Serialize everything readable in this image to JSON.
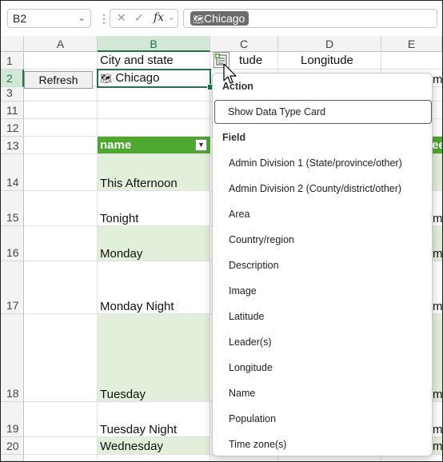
{
  "formula_bar": {
    "name_box": "B2",
    "cancel_glyph": "✕",
    "enter_glyph": "✓",
    "fx_label": "fx",
    "chip_icon": "🗺",
    "chip_text": "Chicago"
  },
  "columns": [
    "A",
    "B",
    "C",
    "D",
    "E"
  ],
  "rows": [
    "1",
    "2",
    "3",
    "11",
    "12",
    "13",
    "14",
    "15",
    "16",
    "17",
    "18",
    "19",
    "20"
  ],
  "cells": {
    "b1": "City and state",
    "c1_partial": "tude",
    "d1": "Longitude",
    "a2_button": "Refresh",
    "b2_icon": "🗺",
    "b2": "Chicago",
    "e2_partial": "mp",
    "b13_header": "name",
    "e13_partial": "ee",
    "b14": "This Afternoon",
    "b15": "Tonight",
    "e15_partial": "mp",
    "b16": "Monday",
    "e16_partial": "mp",
    "b17": "Monday Night",
    "e17_partial": "mp",
    "b18": "Tuesday",
    "e18_partial": "mp",
    "b19": "Tuesday Night",
    "e19_partial": "mp",
    "b20": "Wednesday",
    "e20_partial": "mp"
  },
  "menu": {
    "action_section": "Action",
    "show_card": "Show Data Type Card",
    "field_section": "Field",
    "fields": [
      "Admin Division 1 (State/province/other)",
      "Admin Division 2 (County/district/other)",
      "Area",
      "Country/region",
      "Description",
      "Image",
      "Latitude",
      "Leader(s)",
      "Longitude",
      "Name",
      "Population",
      "Time zone(s)"
    ]
  },
  "colors": {
    "table_header": "#4ea72e",
    "table_band": "#e2efda",
    "selection": "#217346"
  }
}
